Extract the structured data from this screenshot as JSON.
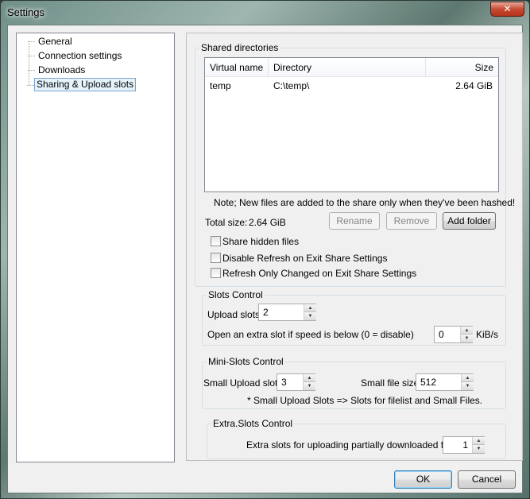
{
  "window": {
    "title": "Settings",
    "close_label": "✕"
  },
  "tree": {
    "items": [
      {
        "label": "General"
      },
      {
        "label": "Connection settings"
      },
      {
        "label": "Downloads"
      },
      {
        "label": "Sharing & Upload slots",
        "selected": true
      }
    ]
  },
  "shared": {
    "title": "Shared directories",
    "columns": [
      "Virtual name",
      "Directory",
      "Size"
    ],
    "rows": [
      {
        "virtual_name": "temp",
        "directory": "C:\\temp\\",
        "size": "2.64 GiB"
      }
    ],
    "note": "Note; New files are added to the share only when they've been hashed!",
    "total_size_label": "Total size:",
    "total_size_value": "2.64 GiB",
    "rename_label": "Rename",
    "remove_label": "Remove",
    "add_folder_label": "Add folder",
    "share_hidden_label": "Share hidden files",
    "disable_refresh_label": "Disable Refresh on Exit Share Settings",
    "refresh_changed_label": "Refresh Only Changed on Exit Share Settings"
  },
  "slots": {
    "title": "Slots Control",
    "upload_slots_label": "Upload slots",
    "upload_slots_value": "2",
    "extra_slot_label": "Open an extra slot if speed is below (0 = disable)",
    "extra_slot_value": "0",
    "extra_slot_unit": "KiB/s"
  },
  "mini": {
    "title": "Mini-Slots Control",
    "small_upload_label": "Small Upload slots",
    "small_upload_value": "3",
    "small_file_label": "Small file size",
    "small_file_value": "512",
    "note": "* Small Upload Slots => Slots for filelist and Small Files."
  },
  "extra": {
    "title": "Extra.Slots Control",
    "label": "Extra slots for uploading partially downloaded files",
    "value": "1"
  },
  "footer": {
    "ok_label": "OK",
    "cancel_label": "Cancel"
  }
}
